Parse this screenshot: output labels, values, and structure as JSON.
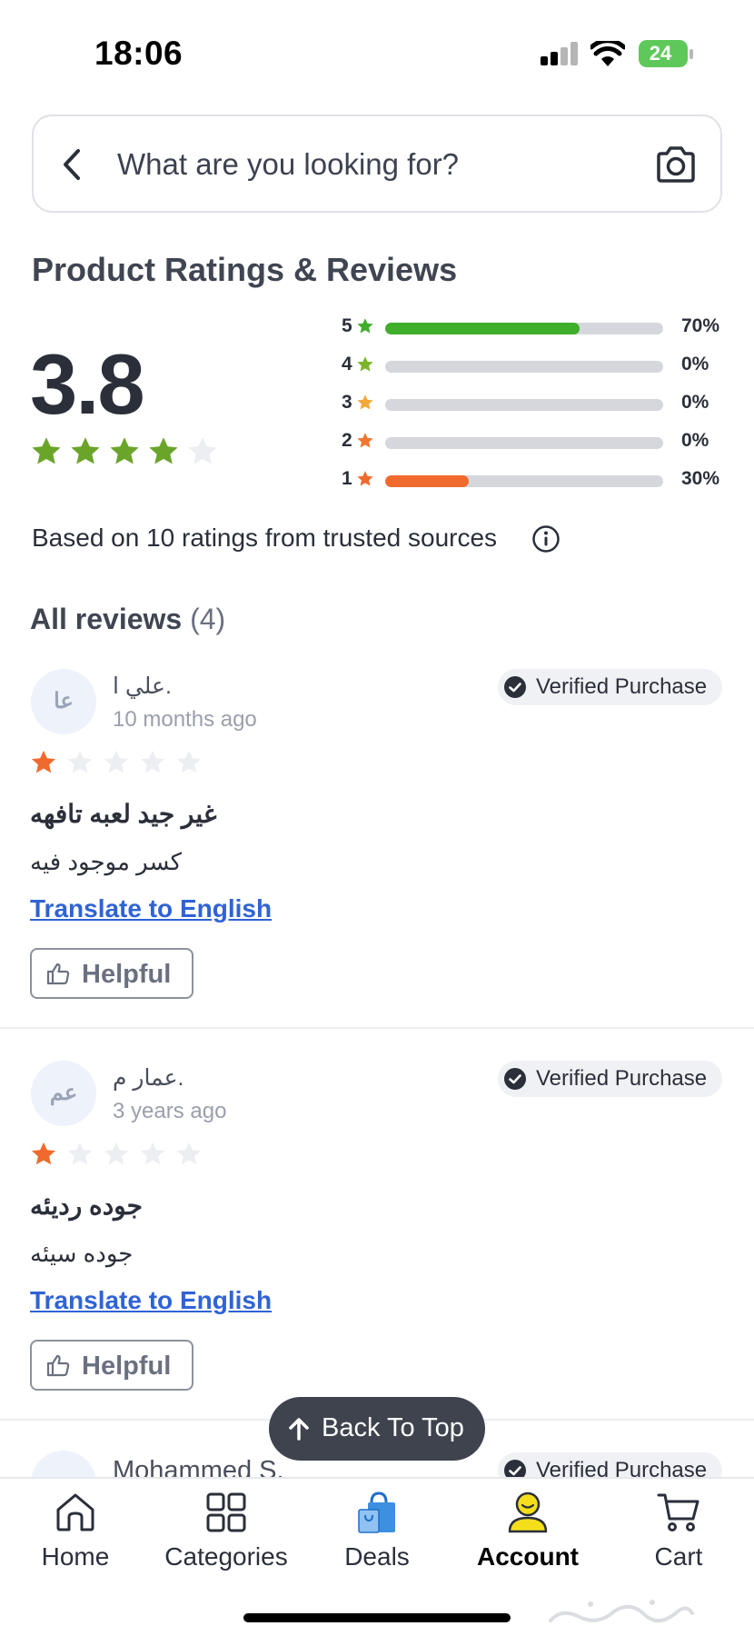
{
  "status_bar": {
    "time": "18:06",
    "battery": "24"
  },
  "search": {
    "placeholder": "What are you looking for?"
  },
  "ratings": {
    "title": "Product Ratings & Reviews",
    "average": "3.8",
    "average_value": 3.8,
    "max_stars": 5,
    "distribution": [
      {
        "stars": "5",
        "percent": "70%",
        "value": 70,
        "color": "#3fae2a"
      },
      {
        "stars": "4",
        "percent": "0%",
        "value": 0,
        "color": "#7bb52a"
      },
      {
        "stars": "3",
        "percent": "0%",
        "value": 0,
        "color": "#f2a93b"
      },
      {
        "stars": "2",
        "percent": "0%",
        "value": 0,
        "color": "#f0772f"
      },
      {
        "stars": "1",
        "percent": "30%",
        "value": 30,
        "color": "#f06a2d"
      }
    ],
    "based_on": "Based on 10 ratings from trusted sources"
  },
  "reviews_section": {
    "title": "All reviews",
    "count": "(4)"
  },
  "reviews": [
    {
      "initials": "عا",
      "name": "علي ا.",
      "date": "10 months ago",
      "verified": "Verified Purchase",
      "rating": 1,
      "title": "غير جيد لعبه تافهه",
      "body": "كسر موجود فيه",
      "translate": "Translate to English",
      "helpful": "Helpful"
    },
    {
      "initials": "عم",
      "name": "عمار م.",
      "date": "3 years ago",
      "verified": "Verified Purchase",
      "rating": 1,
      "title": "جوده رديئه",
      "body": "جوده سيئه",
      "translate": "Translate to English",
      "helpful": "Helpful"
    }
  ],
  "peek_review": {
    "name": "Mohammed S.",
    "verified": "Verified Purchase"
  },
  "back_to_top": "Back To Top",
  "nav": {
    "home": "Home",
    "categories": "Categories",
    "deals": "Deals",
    "account": "Account",
    "cart": "Cart",
    "active": "account"
  },
  "colors": {
    "star_green": "#6aa52a",
    "star_orange": "#f06a2d",
    "star_empty": "#eceef2",
    "link": "#2f63d6",
    "account_yellow": "#f4de1c"
  }
}
